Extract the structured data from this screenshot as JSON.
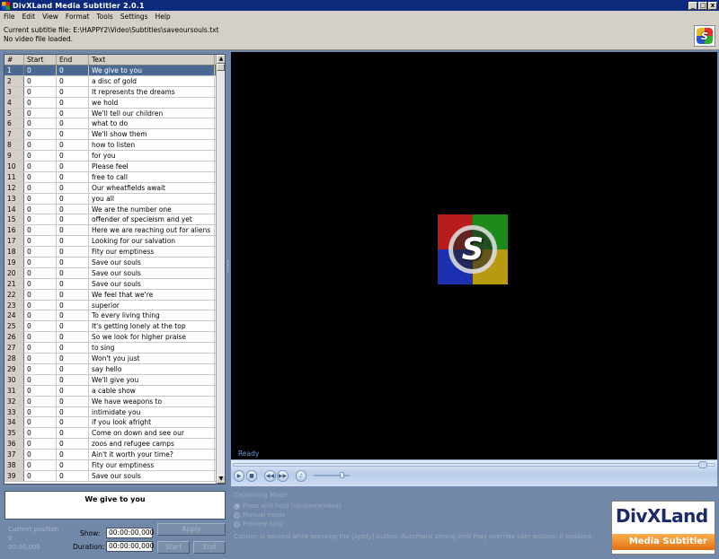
{
  "window": {
    "title": "DivXLand Media Subtitler 2.0.1",
    "min_glyph": "_",
    "max_glyph": "□",
    "close_glyph": "x"
  },
  "menu": [
    "File",
    "Edit",
    "View",
    "Format",
    "Tools",
    "Settings",
    "Help"
  ],
  "info": {
    "subtitle_file": "Current subtitle file: E:\\HAPPY2\\Video\\Subtitles\\saveoursouls.txt",
    "video_status": "No video file loaded."
  },
  "table": {
    "headers": [
      "#",
      "Start",
      "End",
      "Text"
    ],
    "selected_index": 0,
    "rows": [
      [
        "1",
        "0",
        "0",
        "We give to you"
      ],
      [
        "2",
        "0",
        "0",
        "a disc of gold"
      ],
      [
        "3",
        "0",
        "0",
        "It represents the dreams"
      ],
      [
        "4",
        "0",
        "0",
        "we hold"
      ],
      [
        "5",
        "0",
        "0",
        "We'll tell our children"
      ],
      [
        "6",
        "0",
        "0",
        "what to do"
      ],
      [
        "7",
        "0",
        "0",
        "We'll show them"
      ],
      [
        "8",
        "0",
        "0",
        "how to listen"
      ],
      [
        "9",
        "0",
        "0",
        "for you"
      ],
      [
        "10",
        "0",
        "0",
        "Please feel"
      ],
      [
        "11",
        "0",
        "0",
        "free to call"
      ],
      [
        "12",
        "0",
        "0",
        "Our wheatfields await"
      ],
      [
        "13",
        "0",
        "0",
        "you all"
      ],
      [
        "14",
        "0",
        "0",
        "We are the number one"
      ],
      [
        "15",
        "0",
        "0",
        "offender of specieism and yet"
      ],
      [
        "16",
        "0",
        "0",
        "Here we are reaching out for aliens"
      ],
      [
        "17",
        "0",
        "0",
        "Looking for our salvation"
      ],
      [
        "18",
        "0",
        "0",
        "Fity our emptiness"
      ],
      [
        "19",
        "0",
        "0",
        "Save our souls"
      ],
      [
        "20",
        "0",
        "0",
        "Save our souls"
      ],
      [
        "21",
        "0",
        "0",
        "Save our souls"
      ],
      [
        "22",
        "0",
        "0",
        "We feel that we're"
      ],
      [
        "23",
        "0",
        "0",
        "superior"
      ],
      [
        "24",
        "0",
        "0",
        "To every living thing"
      ],
      [
        "25",
        "0",
        "0",
        "It's getting lonely at the top"
      ],
      [
        "26",
        "0",
        "0",
        "So we look for higher praise"
      ],
      [
        "27",
        "0",
        "0",
        "to sing"
      ],
      [
        "28",
        "0",
        "0",
        "Won't you just"
      ],
      [
        "29",
        "0",
        "0",
        "say hello"
      ],
      [
        "30",
        "0",
        "0",
        "We'll give you"
      ],
      [
        "31",
        "0",
        "0",
        "a cable show"
      ],
      [
        "32",
        "0",
        "0",
        "We have weapons to"
      ],
      [
        "33",
        "0",
        "0",
        "intimidate you"
      ],
      [
        "34",
        "0",
        "0",
        "if you look afright"
      ],
      [
        "35",
        "0",
        "0",
        "Come on down and see our"
      ],
      [
        "36",
        "0",
        "0",
        "zoos and refugee camps"
      ],
      [
        "37",
        "0",
        "0",
        "Ain't it worth your time?"
      ],
      [
        "38",
        "0",
        "0",
        "Fity our emptiness"
      ],
      [
        "39",
        "0",
        "0",
        "Save our souls"
      ]
    ]
  },
  "video": {
    "status": "Ready",
    "splash_letter": "S"
  },
  "caption_preview": "We give to you",
  "timing": {
    "current_position_label": "Current position",
    "current_position_value": "0",
    "current_position_time": "00:00,000",
    "show_label": "Show:",
    "show_value": "00:00:00,000",
    "duration_label": "Duration:",
    "duration_value": "00:00:00,000",
    "apply_label": "Apply",
    "start_label": "Start",
    "end_label": "End"
  },
  "captioning_mode": {
    "heading": "Captioning Mode",
    "options": [
      "Press and hold (recommended)",
      "Manual mode",
      "Preview only"
    ],
    "selected": 0,
    "note": "Caption is applied while pressing the [Apply] button. Automatic timing limit may override user actions, if enabled."
  },
  "brand": {
    "line1": "DivXLand",
    "line2": "Media Subtitler"
  },
  "colors": {
    "selection": "#4a6a94",
    "background": "#7288a8",
    "title_bar": "#0c2a7c"
  }
}
